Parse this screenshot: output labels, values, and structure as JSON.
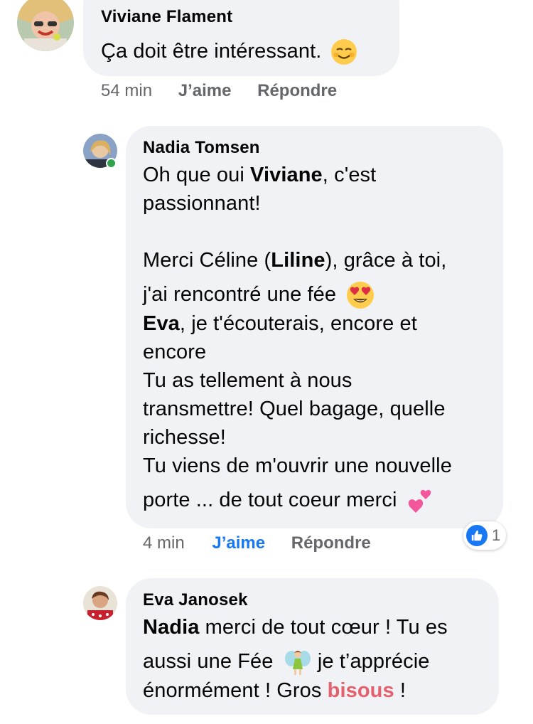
{
  "comments": [
    {
      "author": "Viviane Flament",
      "text": "Ça doit être intéressant.",
      "emoji": "relieved-smile",
      "time": "54 min",
      "like_label": "J’aime",
      "reply_label": "Répondre"
    },
    {
      "author": "Nadia Tomsen",
      "mention_viviane": "Viviane",
      "mention_liline": "Liline",
      "mention_eva": "Eva",
      "line1_pre": "Oh que oui ",
      "line1_post": ", c'est",
      "line2": "passionnant!",
      "line3_pre": "Merci Céline (",
      "line3_post": "), grâce à toi,",
      "line4": "j'ai rencontré une fée",
      "line5_post": ", je t'écouterais, encore et",
      "line6": "encore",
      "line7": "Tu as tellement à nous",
      "line8": "transmettre! Quel bagage, quelle",
      "line9": "richesse!",
      "line10": "Tu viens de m'ouvrir une nouvelle",
      "line11": "porte ... de tout coeur merci",
      "time": "4 min",
      "like_label": "J’aime",
      "reply_label": "Répondre",
      "reaction_count": "1",
      "online": true
    },
    {
      "author": "Eva Janosek",
      "mention_nadia": "Nadia",
      "line1_post": " merci de tout cœur ! Tu es",
      "line2_pre": "aussi une Fée",
      "line2_post": " je t’apprécie",
      "line3_pre": "énormément ! Gros ",
      "line3_highlight": "bisous",
      "line3_post": " !"
    }
  ],
  "colors": {
    "bubble": "#f0f2f5",
    "accent": "#1877f2",
    "muted": "#65676b",
    "highlight": "#e4606d"
  }
}
